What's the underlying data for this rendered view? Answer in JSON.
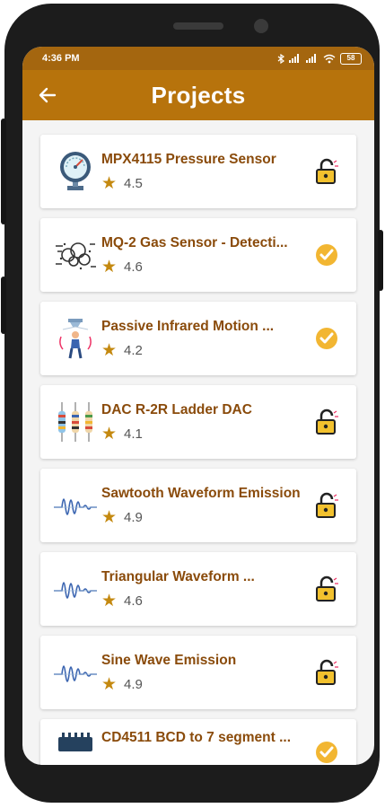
{
  "status_bar": {
    "time": "4:36 PM",
    "battery": "58"
  },
  "app_bar": {
    "title": "Projects",
    "back_icon": "back-arrow-icon"
  },
  "colors": {
    "app_bar": "#b7730c",
    "status_bar": "#a4660f",
    "title_text": "#8a4b0b",
    "star": "#c48910",
    "badge": "#f2b632"
  },
  "projects": [
    {
      "title": "MPX4115 Pressure Sensor",
      "rating": "4.5",
      "icon": "pressure-gauge-icon",
      "status": "locked"
    },
    {
      "title": "MQ-2 Gas Sensor - Detecti...",
      "rating": "4.6",
      "icon": "gas-smoke-icon",
      "status": "completed"
    },
    {
      "title": "Passive Infrared Motion ...",
      "rating": "4.2",
      "icon": "motion-sensor-icon",
      "status": "completed"
    },
    {
      "title": "DAC R-2R Ladder DAC",
      "rating": "4.1",
      "icon": "resistors-icon",
      "status": "locked"
    },
    {
      "title": "Sawtooth Waveform Emission",
      "rating": "4.9",
      "icon": "waveform-icon",
      "status": "locked"
    },
    {
      "title": "Triangular Waveform ...",
      "rating": "4.6",
      "icon": "waveform-icon",
      "status": "locked"
    },
    {
      "title": "Sine Wave Emission",
      "rating": "4.9",
      "icon": "waveform-icon",
      "status": "locked"
    },
    {
      "title": "CD4511 BCD to 7 segment ...",
      "rating": "",
      "icon": "ic-chip-icon",
      "status": "completed"
    }
  ]
}
